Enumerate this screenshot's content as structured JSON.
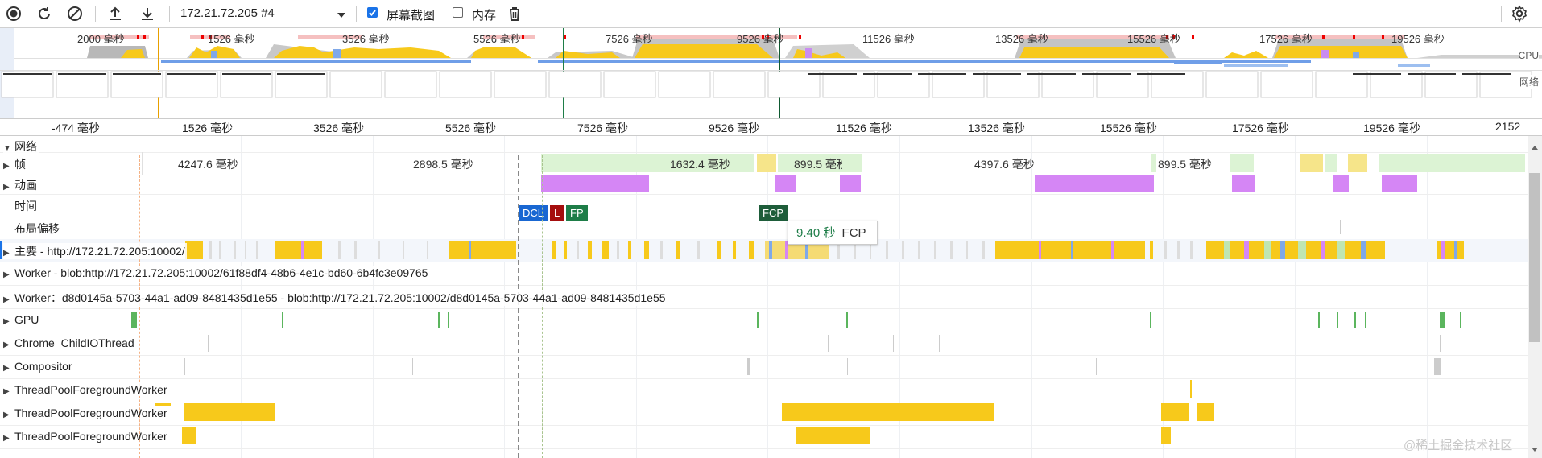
{
  "toolbar": {
    "icons": [
      "record-icon",
      "reload-icon",
      "clear-icon",
      "upload-icon",
      "download-icon",
      "trash-icon",
      "settings-icon"
    ],
    "profile_select": "172.21.72.205 #4",
    "screenshots_label": "屏幕截图",
    "screenshots_checked": true,
    "memory_label": "内存",
    "memory_checked": false
  },
  "overview": {
    "time_labels": [
      "2000 毫秒",
      "1526 毫秒",
      "3526 毫秒",
      "5526 毫秒",
      "7526 毫秒",
      "9526 毫秒",
      "11526 毫秒",
      "13526 毫秒",
      "15526 毫秒",
      "17526 毫秒",
      "19526 毫秒"
    ],
    "cpu_label": "CPU",
    "network_label": "网络"
  },
  "ruler": {
    "ticks": [
      "-474 毫秒",
      "1526 毫秒",
      "3526 毫秒",
      "5526 毫秒",
      "7526 毫秒",
      "9526 毫秒",
      "11526 毫秒",
      "13526 毫秒",
      "15526 毫秒",
      "17526 毫秒",
      "19526 毫秒",
      "2152"
    ]
  },
  "tracks": {
    "network": "网络",
    "frames": "帧",
    "frame_durations": [
      "4247.6 毫秒",
      "2898.5 毫秒",
      "1632.4 毫秒",
      "899.5 毫秒",
      "4397.6 毫秒",
      "899.5 毫秒"
    ],
    "animation": "动画",
    "timings": "时间",
    "timing_markers": [
      "DCL",
      "L",
      "FP",
      "FCP"
    ],
    "layout_shift": "布局偏移",
    "main": "主要 - http://172.21.72.205:10002/",
    "worker1": "Worker - blob:http://172.21.72.205:10002/61f88df4-48b6-4e1c-bd60-6b4fc3e09765",
    "worker2": "Worker：d8d0145a-5703-44a1-ad09-8481435d1e55 - blob:http://172.21.72.205:10002/d8d0145a-5703-44a1-ad09-8481435d1e55",
    "gpu": "GPU",
    "childio": "Chrome_ChildIOThread",
    "compositor": "Compositor",
    "pool1": "ThreadPoolForegroundWorker",
    "pool2": "ThreadPoolForegroundWorker",
    "pool3": "ThreadPoolForegroundWorker"
  },
  "tooltip": {
    "time": "9.40 秒",
    "label": "FCP"
  },
  "watermark": "@稀土掘金技术社区",
  "colors": {
    "scripting": "#f7c91b",
    "rendering": "#d586f5",
    "painting": "#5bb55d",
    "frame_idle": "#dcf3d4",
    "dcl": "#1967d2",
    "load": "#a50e0e",
    "paint": "#1e7d48",
    "selection": "#1a73e8"
  }
}
